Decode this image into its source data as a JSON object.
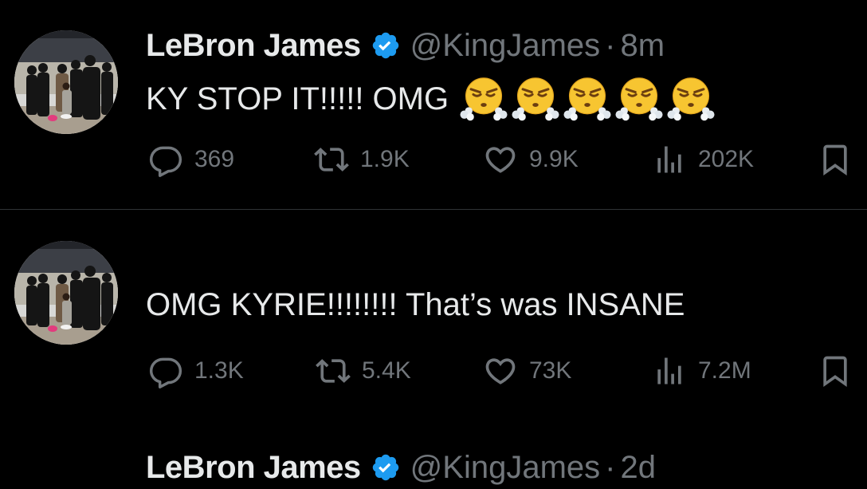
{
  "tweets": [
    {
      "author": {
        "name": "LeBron James",
        "handle": "@KingJames",
        "verified": true
      },
      "separator": "·",
      "time": "8m",
      "text": "KY STOP IT!!!!! OMG",
      "emojis": [
        "face-with-steam-from-nose",
        "face-with-steam-from-nose",
        "face-with-steam-from-nose",
        "face-with-steam-from-nose",
        "face-with-steam-from-nose"
      ],
      "stats": {
        "replies": "369",
        "retweets": "1.9K",
        "likes": "9.9K",
        "views": "202K"
      }
    },
    {
      "author": {
        "name": "LeBron James",
        "handle": "@KingJames",
        "verified": true
      },
      "separator": "·",
      "time": "2d",
      "text": "OMG KYRIE!!!!!!!! That’s was INSANE",
      "emojis": [],
      "stats": {
        "replies": "1.3K",
        "retweets": "5.4K",
        "likes": "73K",
        "views": "7.2M"
      }
    }
  ],
  "colors": {
    "background": "#000000",
    "primary_text": "#e7e9ea",
    "secondary_text": "#71767b",
    "verified_badge": "#1d9bf0",
    "divider": "#2f3336"
  },
  "icons": {
    "reply": "reply-icon",
    "retweet": "retweet-icon",
    "like": "heart-icon",
    "views": "views-icon",
    "bookmark": "bookmark-icon",
    "verified": "verified-badge-icon"
  }
}
